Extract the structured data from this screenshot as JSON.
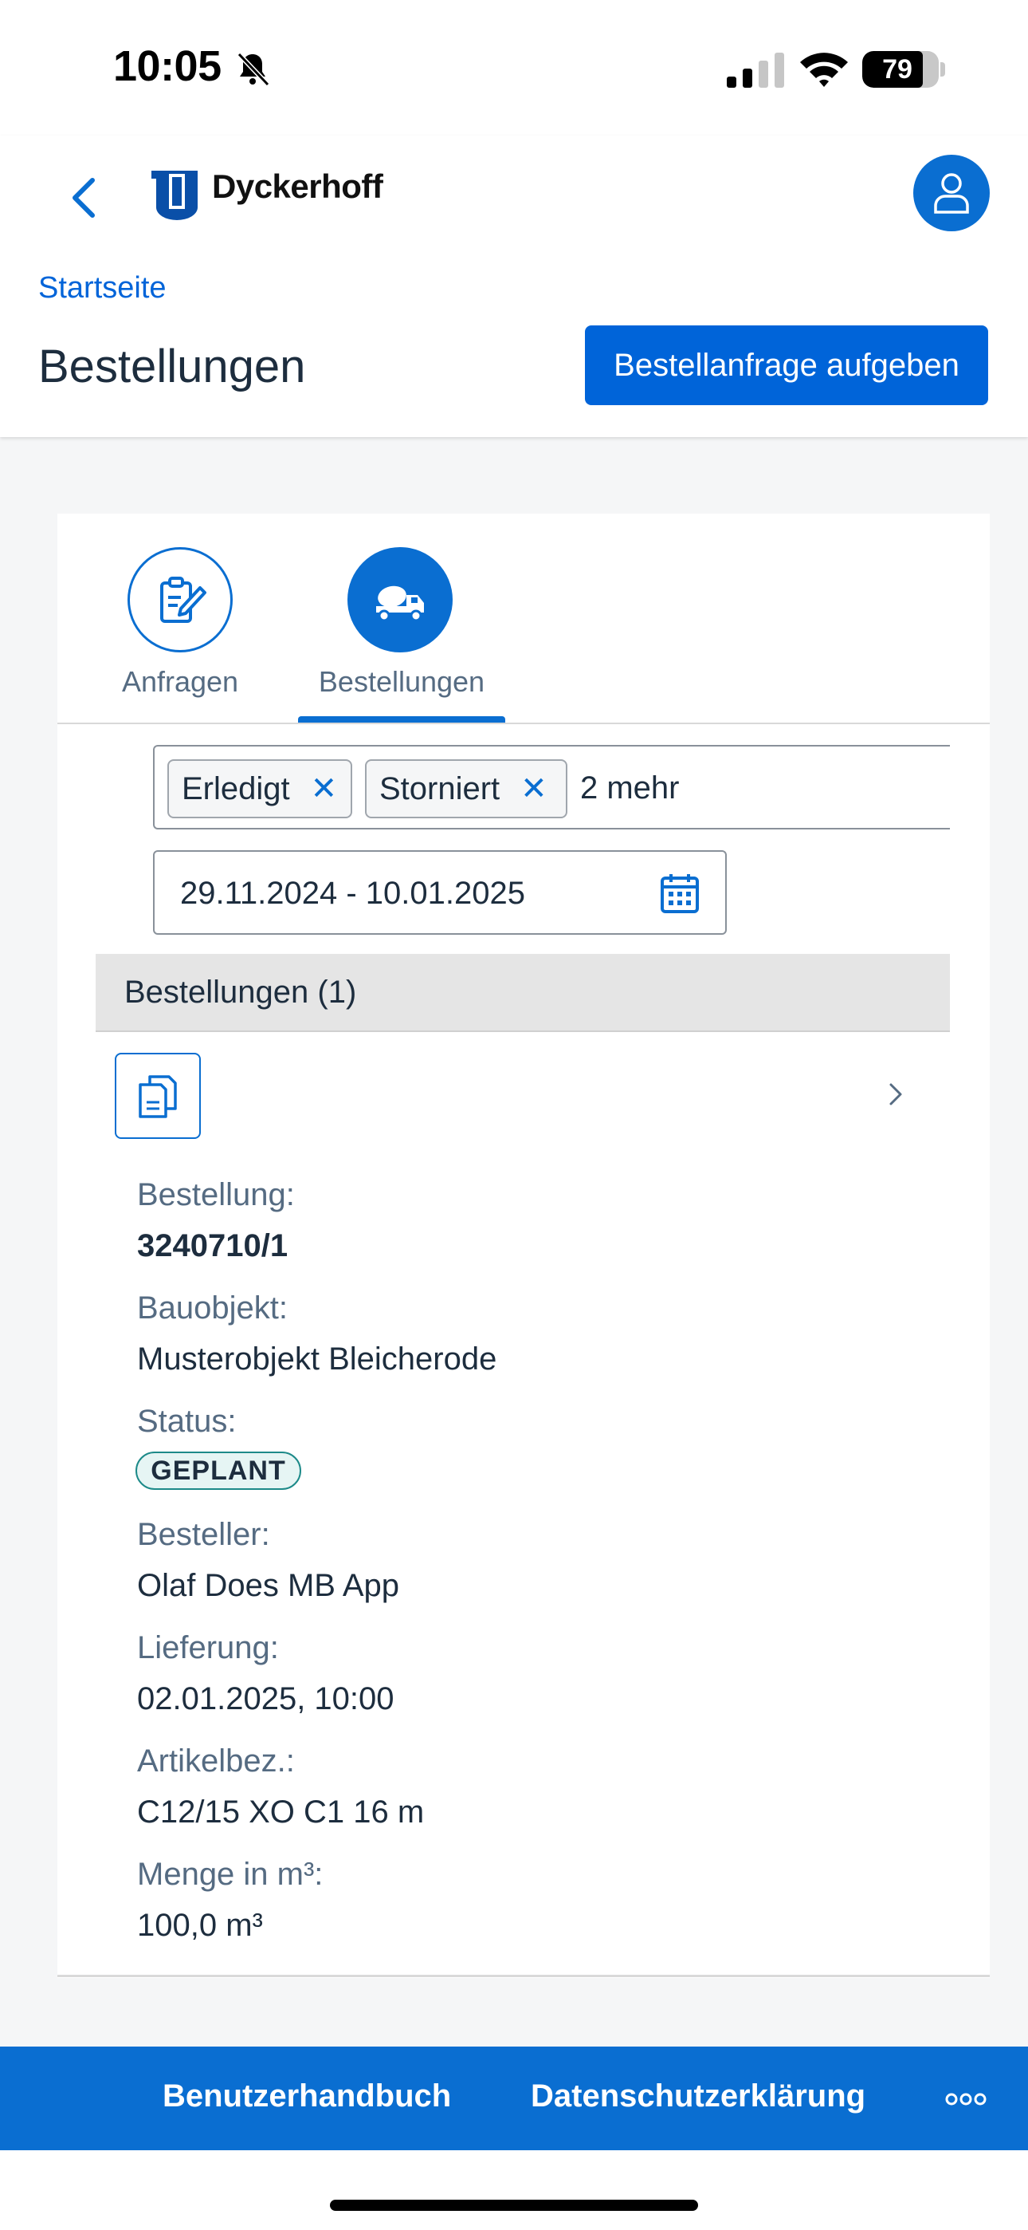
{
  "status_bar": {
    "time": "10:05",
    "battery_level": "79",
    "battery_fraction": 0.79
  },
  "header": {
    "brand": "Dyckerhoff",
    "breadcrumb": "Startseite",
    "title": "Bestellungen",
    "primary_action": "Bestellanfrage aufgeben"
  },
  "tabs": [
    {
      "label": "Anfragen",
      "icon": "form-edit-icon",
      "selected": false
    },
    {
      "label": "Bestellungen",
      "icon": "concrete-truck-icon",
      "selected": true
    }
  ],
  "filters": {
    "tokens": [
      "Erledigt",
      "Storniert"
    ],
    "more": "2 mehr",
    "date_range": "29.11.2024 - 10.01.2025"
  },
  "list": {
    "header": "Bestellungen (1)",
    "item": {
      "order_label": "Bestellung:",
      "order_value": "3240710/1",
      "project_label": "Bauobjekt:",
      "project_value": "Musterobjekt Bleicherode",
      "status_label": "Status:",
      "status_value": "GEPLANT",
      "orderer_label": "Besteller:",
      "orderer_value": "Olaf Does MB App",
      "delivery_label": "Lieferung:",
      "delivery_value": "02.01.2025, 10:00",
      "article_label": "Artikelbez.:",
      "article_value": "C12/15 XO C1 16 m",
      "quantity_label": "Menge in m³:",
      "quantity_value": "100,0 m³"
    }
  },
  "footer": {
    "links": [
      "Benutzerhandbuch",
      "Datenschutzerklärung"
    ]
  },
  "colors": {
    "brand_blue": "#0a6ed1",
    "button_blue": "#0064d9",
    "status_badge_border": "#1d8a89"
  }
}
